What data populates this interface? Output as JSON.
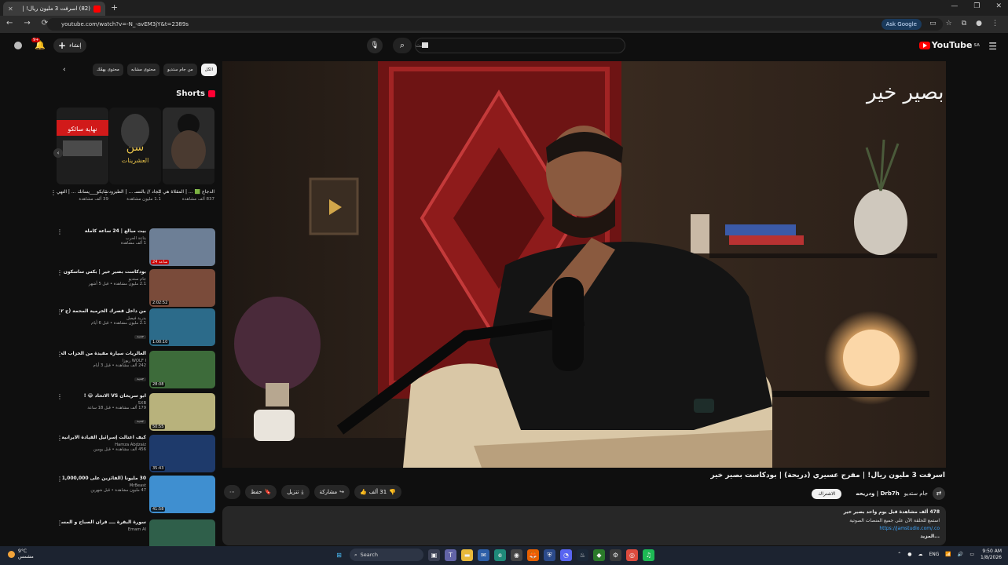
{
  "browser": {
    "tab_title": "(82) اسرفت 3 مليون ريال! |",
    "url": "youtube.com/watch?v=-N_-avEM3jY&t=2389s",
    "ask_google": "Ask Google"
  },
  "masthead": {
    "logo": "YouTube",
    "logo_region": "SA",
    "search_placeholder": "بحث",
    "create_label": "إنشاء",
    "notif_count": "9+"
  },
  "video": {
    "title": "اسرفت 3 مليون ريال! | مفرج عسيري (دريحة) | بودكاست بصير خير",
    "brand_mark": "بصير خير",
    "channel": "Drb7h | ودريحه",
    "channel_extra": "جام ستديو",
    "subscribe": "الاشتراك",
    "likes": "31 ألف",
    "share": "مشاركة",
    "download": "تنزيل",
    "save": "حفظ",
    "desc_stats": "478 ألف مشاهدة  قبل يوم واحد  بصير خير",
    "desc_line2": "استمع للحلقة الآن على جميع المنصات الصوتية",
    "desc_link": "https://jamstudio.com/.co",
    "desc_more": "...المزيد"
  },
  "chips": [
    "الكل",
    "من جام ستديو",
    "محتوى مشابه",
    "محتوى يهمّك"
  ],
  "shorts": {
    "heading": "Shorts",
    "items": [
      {
        "title": "الدجاج 🟩 ... | المقلاة هي الدافع",
        "views": "837 ألف مشاهدة",
        "color": "#2a2a2a"
      },
      {
        "title": "الجاد // بالنسـ ... | الطيزونات بين",
        "views": "1.1 مليون مشاهدة",
        "color": "#1b1b1b"
      },
      {
        "title": "سايكو___يسانك ... | التهي",
        "views": "39 ألف مشاهدة",
        "color": "#3a1515"
      }
    ],
    "short_banner": "نهاية سائكو"
  },
  "recs": [
    {
      "title": "بيت مبالغ | 24 ساعة كاملة",
      "channel": "بتاعة الحرب",
      "views": "1 ألف مشاهدة",
      "dur": "24 ساعة",
      "color": "#6d7f96"
    },
    {
      "title": "بودكاست بصير خير | بكس ساسكون على مقطع - عبدالرحمن الشهري",
      "channel": "جام ستديو",
      "views": "2.1 مليون مشاهدة • قبل 5 أشهر",
      "dur": "2:02:52",
      "color": "#7a4b3a"
    },
    {
      "title": "من داخل قصرك الخرمية المحمة (ج ٢) - بودكاست رحلة الايجار الموسم الثالث",
      "channel": "بدرية فيصل",
      "views": "2.1 مليون مشاهدة • قبل 6 أيام",
      "dur": "1:00:10",
      "color": "#2c6b8a",
      "badge": "جديد"
    },
    {
      "title": "ألعالريات سيارة مقيدة من الخزاب الحقيبة سمعي 😂 !!",
      "channel": "WOLF I ريوزا",
      "views": "242 ألف مشاهدة • قبل 3 أيام",
      "dur": "28:08",
      "color": "#3d6b3a",
      "badge": "جديد"
    },
    {
      "title": "ابو سريحان VS الاتحاد 😂 !",
      "channel": "SXB",
      "views": "179 ألف مشاهدة • قبل 18 ساعة",
      "dur": "50:55",
      "color": "#b8b27c",
      "badge": "جديد"
    },
    {
      "title": "كيف اغتالت إسرائيل القيادة الايرانية ؟ (الدكال حزام) 🤔",
      "channel": "Hamza Abdzaiz",
      "views": "456 ألف مشاهدة • قبل يومين",
      "dur": "35:43",
      "color": "#1e3a6b"
    },
    {
      "title": "30 مليوناً (الفائزين على 1,000,000 دولار)",
      "channel": "MrBeast",
      "views": "47 مليون مشاهدة • قبل شهرين",
      "dur": "41:58",
      "color": "#3f8fd0"
    },
    {
      "title": "سورة البقرة ــــ قرآن الصباح و المساء بصوت فضيلة الشيخ عبد الرحمن السديس",
      "channel": "Emam Al",
      "views": "",
      "dur": "",
      "color": "#2f5f4a"
    }
  ],
  "taskbar": {
    "temp": "9°C",
    "weather": "مشمس",
    "search": "Search",
    "lang": "ENG",
    "time": "9:50 AM",
    "date": "1/8/2026"
  }
}
